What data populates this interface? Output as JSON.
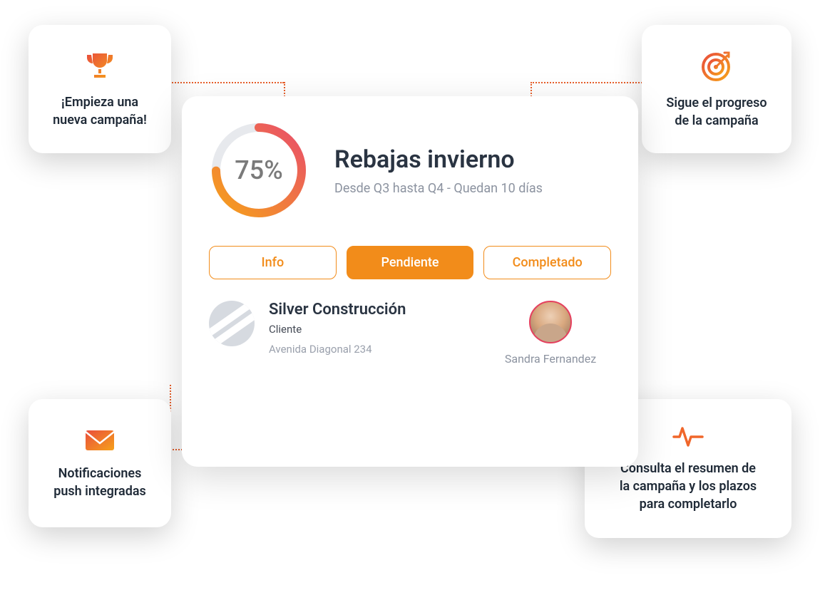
{
  "callouts": {
    "top_left": "¡Empieza una nueva campaña!",
    "top_right": "Sigue el progreso de la campaña",
    "bottom_left": "Notificaciones push integradas",
    "bottom_right": "Consulta el resumen de la campaña y los plazos para completarlo"
  },
  "campaign": {
    "progress_pct": 75,
    "progress_label": "75%",
    "title": "Rebajas invierno",
    "subtitle": "Desde Q3 hasta Q4 - Quedan 10 días"
  },
  "tabs": {
    "info": "Info",
    "pending": "Pendiente",
    "completed": "Completado",
    "active": "pending"
  },
  "client": {
    "name": "Silver Construcción",
    "type": "Cliente",
    "address": "Avenida Diagonal 234"
  },
  "assignee": {
    "name": "Sandra Fernandez"
  },
  "colors": {
    "accent": "#f28c1a",
    "gradient_start": "#e94e3c",
    "gradient_end": "#f6a11a"
  },
  "icons": {
    "trophy": "trophy-icon",
    "target": "target-icon",
    "mail": "mail-icon",
    "activity": "activity-icon"
  }
}
